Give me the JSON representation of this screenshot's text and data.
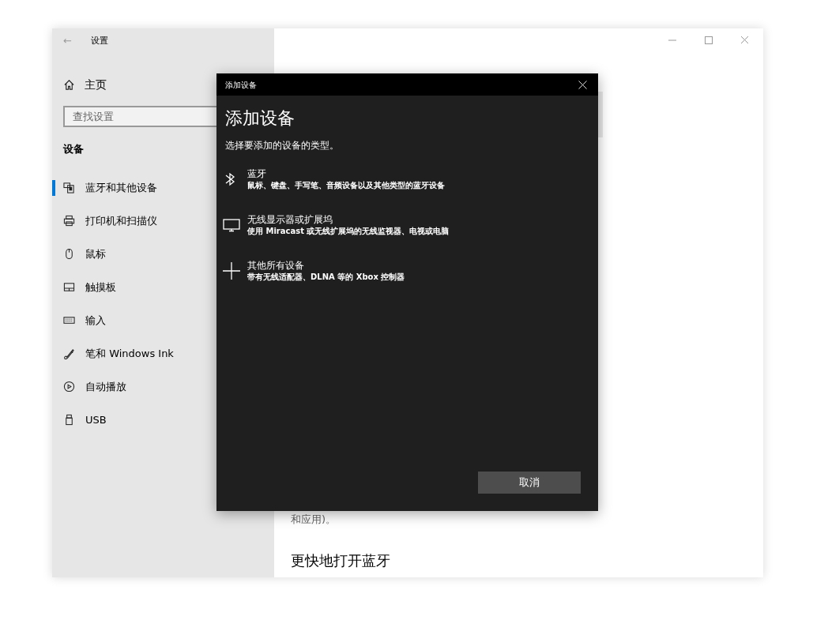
{
  "window": {
    "title": "设置",
    "back": "←"
  },
  "sidebar": {
    "home": "主页",
    "search": {
      "placeholder": "查找设置"
    },
    "section": "设备",
    "items": [
      {
        "label": "蓝牙和其他设备",
        "selected": true
      },
      {
        "label": "打印机和扫描仪",
        "selected": false
      },
      {
        "label": "鼠标",
        "selected": false
      },
      {
        "label": "触摸板",
        "selected": false
      },
      {
        "label": "输入",
        "selected": false
      },
      {
        "label": "笔和 Windows Ink",
        "selected": false
      },
      {
        "label": "自动播放",
        "selected": false
      },
      {
        "label": "USB",
        "selected": false
      }
    ]
  },
  "content": {
    "paragraph_end": "和应用)。",
    "subheading": "更快地打开蓝牙"
  },
  "dialog": {
    "title": "添加设备",
    "heading": "添加设备",
    "prompt": "选择要添加的设备的类型。",
    "options": [
      {
        "title": "蓝牙",
        "description": "鼠标、键盘、手写笔、音频设备以及其他类型的蓝牙设备"
      },
      {
        "title": "无线显示器或扩展坞",
        "description": "使用 Miracast 或无线扩展坞的无线监视器、电视或电脑"
      },
      {
        "title": "其他所有设备",
        "description": "带有无线适配器、DLNA 等的 Xbox 控制器"
      }
    ],
    "cancel": "取消"
  }
}
